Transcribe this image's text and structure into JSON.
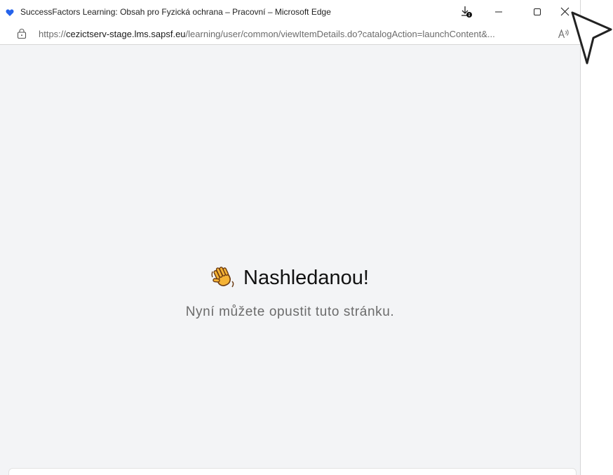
{
  "window": {
    "title": "SuccessFactors Learning: Obsah pro Fyzická ochrana – Pracovní – Microsoft Edge"
  },
  "address_bar": {
    "url_protocol": "https://",
    "url_host": "cezictserv-stage.lms.sapsf.eu",
    "url_path": "/learning/user/common/viewItemDetails.do?catalogAction=launchContent&..."
  },
  "page": {
    "heading": "Nashledanou!",
    "subtext": "Nyní můžete opustit tuto stránku."
  },
  "icons": {
    "app": "heart-icon",
    "download": "download-icon",
    "minimize": "minimize-icon",
    "maximize": "maximize-icon",
    "close": "close-icon",
    "lock": "lock-icon",
    "read_aloud": "read-aloud-icon",
    "wave": "waving-hand-icon",
    "cursor": "mouse-cursor-icon"
  },
  "colors": {
    "page_background": "#f3f4f6",
    "heart": "#2563eb",
    "wave_hand": "#f5b335"
  }
}
